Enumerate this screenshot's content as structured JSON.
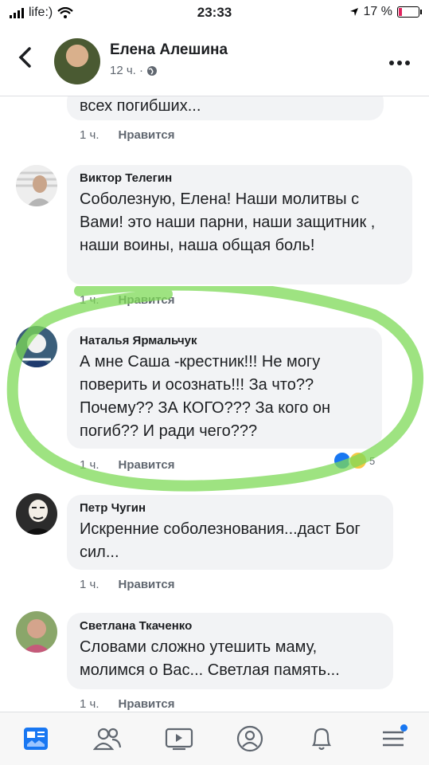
{
  "status": {
    "carrier": "life:)",
    "time": "23:33",
    "battery": "17 %"
  },
  "header": {
    "name": "Елена Алешина",
    "time": "12 ч. ·"
  },
  "comments": [
    {
      "author": "",
      "text": "всех погибших...",
      "time": "1 ч.",
      "like": "Нравится"
    },
    {
      "author": "Виктор Телегин",
      "text": "Соболезную, Елена! Наши молитвы с Вами! это наши парни, наши защитник , наши воины, наша общая боль!",
      "time": "1 ч.",
      "like": "Нравится"
    },
    {
      "author": "Наталья Ярмальчук",
      "text": "А мне Саша -крестник!!! Не могу поверить и осознать!!! За что?? Почему?? ЗА КОГО??? За кого он погиб?? И ради чего???",
      "time": "1 ч.",
      "like": "Нравится",
      "reactions": "5"
    },
    {
      "author": "Петр Чугин",
      "text": "Искренние соболезнования...даст Бог сил...",
      "time": "1 ч.",
      "like": "Нравится"
    },
    {
      "author": "Светлана Ткаченко",
      "text": "Словами сложно утешить маму, молимся о Вас... Светлая память...",
      "time": "1 ч.",
      "like": "Нравится"
    }
  ],
  "colors": {
    "accent": "#1877f2",
    "highlight": "#7ed957",
    "bubble": "#f2f3f5"
  }
}
